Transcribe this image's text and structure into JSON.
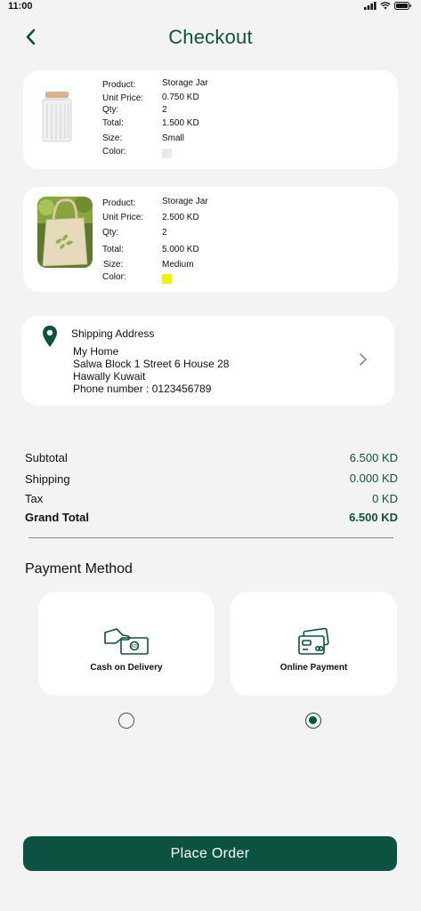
{
  "status": {
    "time": "11:00"
  },
  "header": {
    "title": "Checkout"
  },
  "products": [
    {
      "labels": {
        "product": "Product:",
        "unit_price": "Unit Price:",
        "qty": "Qty:",
        "total": "Total:",
        "size": "Size:",
        "color": "Color:"
      },
      "product": "Storage Jar",
      "unit_price": "0.750 KD",
      "qty": "2",
      "total": "1.500 KD",
      "size": "Small",
      "color_hex": "#e9e9ee"
    },
    {
      "labels": {
        "product": "Product:",
        "unit_price": "Unit Price:",
        "qty": "Qty:",
        "total": "Total:",
        "size": "Size:",
        "color": "Color:"
      },
      "product": "Storage Jar",
      "unit_price": "2.500 KD",
      "qty": "2",
      "total": "5.000 KD",
      "size": "Medium",
      "color_hex": "#f5f000"
    }
  ],
  "address": {
    "title": "Shipping Address",
    "name": "My Home",
    "line1": "Salwa Block 1 Street 6 House 28",
    "line2": "Hawally Kuwait",
    "phone": "Phone number : 0123456789"
  },
  "summary": {
    "subtotal_label": "Subtotal",
    "subtotal": "6.500 KD",
    "shipping_label": "Shipping",
    "shipping": "0.000 KD",
    "tax_label": "Tax",
    "tax": "0 KD",
    "grand_total_label": "Grand Total",
    "grand_total": "6.500 KD"
  },
  "payment": {
    "title": "Payment Method",
    "options": [
      {
        "label": "Cash on Delivery",
        "selected": false
      },
      {
        "label": "Online Payment",
        "selected": true
      }
    ]
  },
  "actions": {
    "place_order": "Place Order"
  },
  "colors": {
    "brand": "#0b5340",
    "background": "#f3f3f3"
  }
}
